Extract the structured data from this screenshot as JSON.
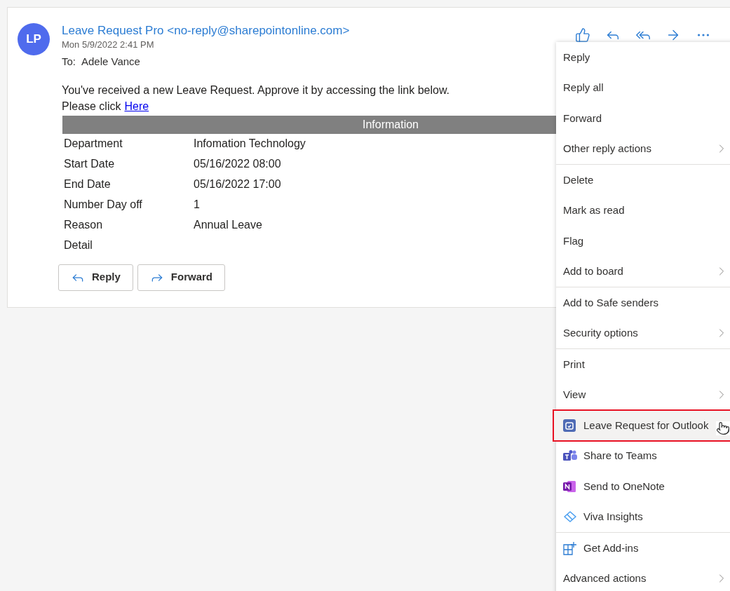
{
  "message": {
    "avatar_initials": "LP",
    "sender": "Leave Request Pro <no-reply@sharepointonline.com>",
    "date": "Mon 5/9/2022 2:41 PM",
    "to_label": "To:",
    "to": "Adele Vance",
    "body_line": "You've received a new Leave Request. Approve it by accessing the link below.",
    "click_prefix": "Please click",
    "link": "Here",
    "table": {
      "header": "Information",
      "rows": [
        {
          "label": "Department",
          "value": "Infomation Technology"
        },
        {
          "label": "Start Date",
          "value": "05/16/2022 08:00"
        },
        {
          "label": "End Date",
          "value": "05/16/2022 17:00"
        },
        {
          "label": "Number Day off",
          "value": "1"
        },
        {
          "label": "Reason",
          "value": "Annual Leave"
        },
        {
          "label": "Detail",
          "value": ""
        }
      ]
    },
    "buttons": [
      {
        "kind": "reply",
        "label": "Reply"
      },
      {
        "kind": "forward",
        "label": "Forward"
      }
    ]
  },
  "toolbar": [
    {
      "kind": "like"
    },
    {
      "kind": "reply"
    },
    {
      "kind": "reply-all"
    },
    {
      "kind": "forward"
    },
    {
      "kind": "more"
    }
  ],
  "menu": {
    "groups": [
      [
        {
          "label": "Reply",
          "kind": "plain",
          "submenu": false,
          "highlighted": false
        },
        {
          "label": "Reply all",
          "kind": "plain",
          "submenu": false,
          "highlighted": false
        },
        {
          "label": "Forward",
          "kind": "plain",
          "submenu": false,
          "highlighted": false
        },
        {
          "label": "Other reply actions",
          "kind": "plain",
          "submenu": true,
          "highlighted": false
        }
      ],
      [
        {
          "label": "Delete",
          "kind": "plain",
          "submenu": false,
          "highlighted": false
        },
        {
          "label": "Mark as read",
          "kind": "plain",
          "submenu": false,
          "highlighted": false
        },
        {
          "label": "Flag",
          "kind": "plain",
          "submenu": false,
          "highlighted": false
        },
        {
          "label": "Add to board",
          "kind": "plain",
          "submenu": true,
          "highlighted": false
        }
      ],
      [
        {
          "label": "Add to Safe senders",
          "kind": "plain",
          "submenu": false,
          "highlighted": false
        },
        {
          "label": "Security options",
          "kind": "plain",
          "submenu": true,
          "highlighted": false
        }
      ],
      [
        {
          "label": "Print",
          "kind": "plain",
          "submenu": false,
          "highlighted": false
        },
        {
          "label": "View",
          "kind": "plain",
          "submenu": true,
          "highlighted": false
        },
        {
          "label": "Leave Request for Outlook",
          "kind": "leave",
          "submenu": false,
          "highlighted": true
        },
        {
          "label": "Share to Teams",
          "kind": "teams",
          "submenu": false,
          "highlighted": false
        },
        {
          "label": "Send to OneNote",
          "kind": "onenote",
          "submenu": false,
          "highlighted": false
        },
        {
          "label": "Viva Insights",
          "kind": "viva",
          "submenu": false,
          "highlighted": false
        }
      ],
      [
        {
          "label": "Get Add-ins",
          "kind": "addins",
          "submenu": false,
          "highlighted": false
        },
        {
          "label": "Advanced actions",
          "kind": "plain",
          "submenu": true,
          "highlighted": false
        }
      ]
    ]
  }
}
